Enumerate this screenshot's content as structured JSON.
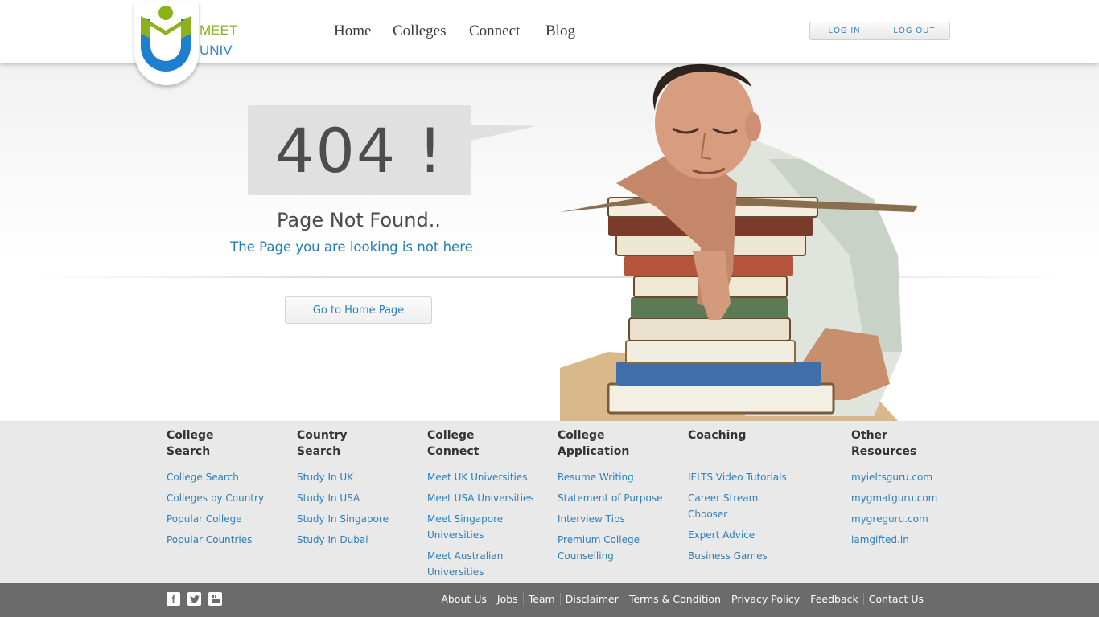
{
  "header": {
    "logo_meet": "MEET",
    "logo_univ": "UNIV",
    "nav": [
      "Home",
      "Colleges",
      "Connect",
      "Blog"
    ],
    "login": "LOG IN",
    "logout": "LOG OUT"
  },
  "error": {
    "code": "404 !",
    "title": "Page Not Found..",
    "subtitle": "The Page you are looking is not here",
    "button": "Go to Home Page"
  },
  "footer": {
    "columns": [
      {
        "heading": [
          "College",
          "Search"
        ],
        "links": [
          "College Search",
          "Colleges by Country",
          "Popular College",
          "Popular Countries"
        ]
      },
      {
        "heading": [
          "Country",
          "Search"
        ],
        "links": [
          "Study In UK",
          "Study In USA",
          "Study In Singapore",
          "Study In Dubai"
        ]
      },
      {
        "heading": [
          "College",
          "Connect"
        ],
        "links": [
          "Meet UK Universities",
          "Meet USA Universities",
          "Meet Singapore Universities",
          "Meet Australian Universities"
        ]
      },
      {
        "heading": [
          "College",
          "Application"
        ],
        "links": [
          "Resume Writing",
          "Statement of Purpose",
          "Interview Tips",
          "Premium College Counselling"
        ]
      },
      {
        "heading": [
          "Coaching",
          ""
        ],
        "links": [
          "IELTS Video Tutorials",
          "Career Stream Chooser",
          "Expert Advice",
          "Business Games"
        ]
      },
      {
        "heading": [
          "Other",
          "Resources"
        ],
        "links": [
          "myieltsguru.com",
          "mygmatguru.com",
          "mygreguru.com",
          "iamgifted.in"
        ]
      }
    ]
  },
  "bottom": {
    "social_icons": [
      "facebook-icon",
      "twitter-icon",
      "youtube-icon"
    ],
    "links": [
      "About Us",
      "Jobs",
      "Team",
      "Disclaimer",
      "Terms & Condition",
      "Privacy Policy",
      "Feedback",
      "Contact Us"
    ]
  },
  "colors": {
    "accent_blue": "#2a7fbd",
    "logo_green": "#8cb21b",
    "footer_bar": "#6b6b6b"
  }
}
